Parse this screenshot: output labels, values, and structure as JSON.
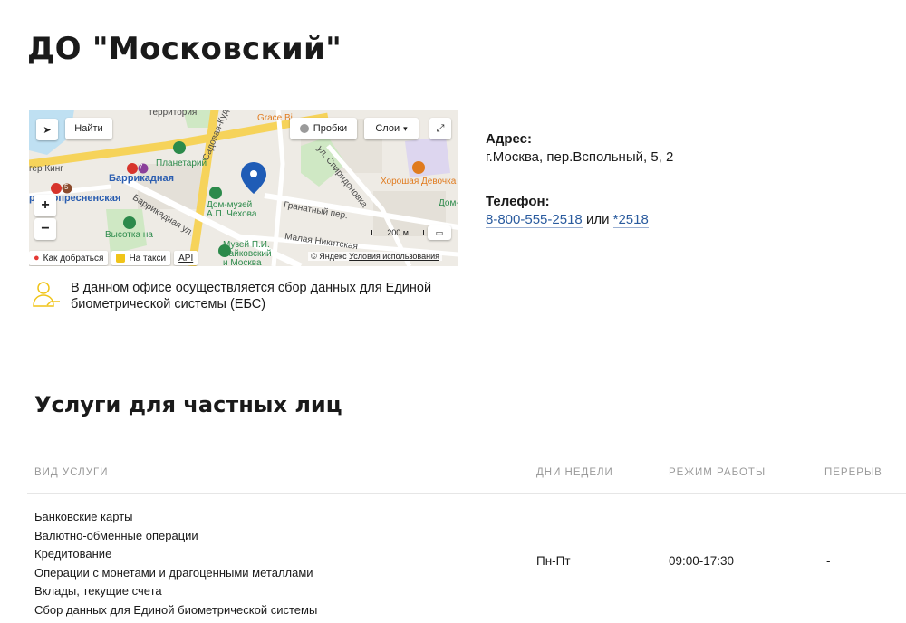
{
  "page": {
    "title": "ДО \"Московский\""
  },
  "map": {
    "buttons": {
      "find": "Найти",
      "traffic": "Пробки",
      "layers": "Слои"
    },
    "labels": {
      "territory": "территория",
      "grace_bistro": "Grace Bi",
      "sadovaya": "Садовая-Куд",
      "planetarium": "Планетарий",
      "burger_king": "гер Кинг",
      "barrikadnaya_metro": "Баррикадная",
      "metro_line_7": "7",
      "metro_line_5": "5",
      "krasnopresnenskaya": "раснопресненская",
      "barrikadnaya_street": "Баррикадная ул.",
      "chekhov_museum": "Дом-музей А.П. Чехова",
      "granatny": "Гранатный пер.",
      "spiridonovka": "ул. Спиридоновка",
      "horoshaya_devochka": "Хорошая Девочка",
      "vysotka": "Высотка на",
      "tchaikovsky_museum": "Музей П.И. Чайковский и Москва",
      "malaya_nikitskaya": "Малая Никитская",
      "dom_m": "Дом-"
    },
    "scale_label": "200 м",
    "footer": {
      "route": "Как добраться",
      "taxi": "На такси",
      "api": "API"
    },
    "copyright": {
      "brand": "© Яндекс",
      "terms": "Условия использования"
    }
  },
  "contact": {
    "address_label": "Адрес:",
    "address_value": "г.Москва, пер.Вспольный, 5, 2",
    "phone_label": "Телефон:",
    "phone_primary": "8-800-555-2518",
    "phone_separator": "или",
    "phone_short": "*2518"
  },
  "ebs_notice": "В данном офисе осуществляется сбор данных для Единой биометрической системы (ЕБС)",
  "services_section": {
    "title": "Услуги для частных лиц",
    "columns": [
      "ВИД УСЛУГИ",
      "ДНИ НЕДЕЛИ",
      "РЕЖИМ РАБОТЫ",
      "ПЕРЕРЫВ"
    ],
    "rows": [
      {
        "services": [
          "Банковские карты",
          "Валютно-обменные операции",
          "Кредитование",
          "Операции с монетами и драгоценными металлами",
          "Вклады, текущие счета",
          "Сбор данных для Единой биометрической системы"
        ],
        "days": "Пн-Пт",
        "hours": "09:00-17:30",
        "break": "-"
      }
    ]
  },
  "colors": {
    "link": "#2a5b9e",
    "map_pin": "#1f5cb6",
    "metro": "#d7342c",
    "icon_yellow": "#f0c419"
  }
}
